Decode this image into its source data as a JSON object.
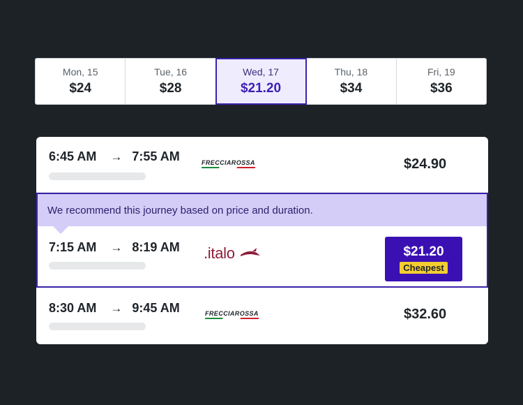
{
  "dates": [
    {
      "day": "Mon, 15",
      "price": "$24",
      "selected": false
    },
    {
      "day": "Tue, 16",
      "price": "$28",
      "selected": false
    },
    {
      "day": "Wed, 17",
      "price": "$21.20",
      "selected": true
    },
    {
      "day": "Thu, 18",
      "price": "$34",
      "selected": false
    },
    {
      "day": "Fri, 19",
      "price": "$36",
      "selected": false
    }
  ],
  "journeys": [
    {
      "depart": "6:45 AM",
      "arrow": "→",
      "arrive": "7:55 AM",
      "operator": "FRECCIAROSSA",
      "price": "$24.90"
    },
    {
      "depart": "7:15 AM",
      "arrow": "→",
      "arrive": "8:19 AM",
      "operator": ".italo",
      "price": "$21.20",
      "badge": "Cheapest"
    },
    {
      "depart": "8:30 AM",
      "arrow": "→",
      "arrive": "9:45 AM",
      "operator": "FRECCIAROSSA",
      "price": "$32.60"
    }
  ],
  "recommendation": "We recommend this journey based on price and duration.",
  "colors": {
    "background": "#1c2226",
    "accent": "#3b22a8",
    "banner": "#d4cdf8",
    "badge": "#f4cd2f",
    "italo": "#8e1c3a"
  }
}
